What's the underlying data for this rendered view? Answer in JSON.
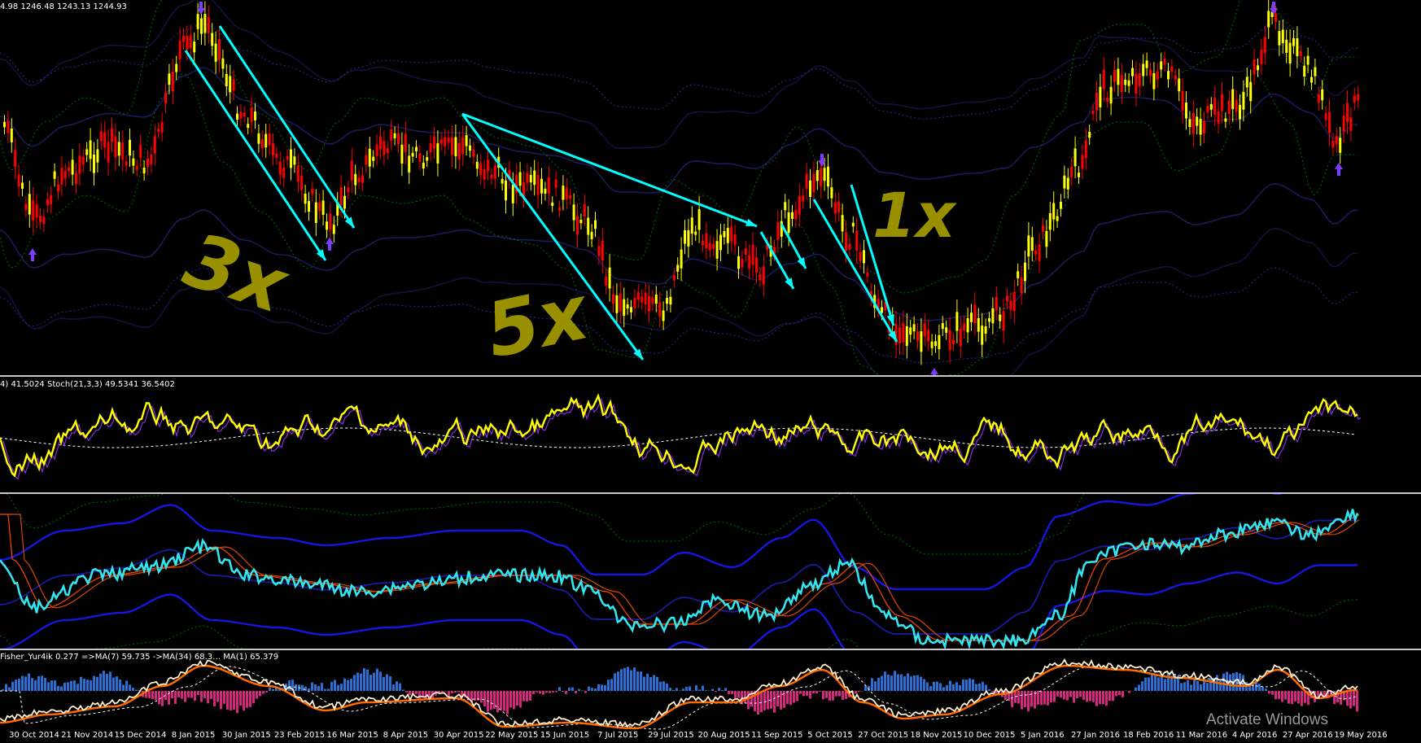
{
  "main_pane": {
    "ohlc_label": "4.98 1246.48 1243.13 1244.93",
    "annotations": [
      "3x",
      "5x",
      "1x"
    ]
  },
  "stoch_pane": {
    "label": "4) 41.5024   Stoch(21,3,3) 49.5341 36.5402"
  },
  "fisher_pane": {
    "label": "Fisher_Yur4ik 0.277  =>MA(7) 59.735  ->MA(34) 68.3… MA(1) 65.379"
  },
  "time_axis": [
    "30 Oct 2014",
    "21 Nov 2014",
    "15 Dec 2014",
    "8 Jan 2015",
    "30 Jan 2015",
    "23 Feb 2015",
    "16 Mar 2015",
    "8 Apr 2015",
    "30 Apr 2015",
    "22 May 2015",
    "15 Jun 2015",
    "7 Jul 2015",
    "29 Jul 2015",
    "20 Aug 2015",
    "11 Sep 2015",
    "5 Oct 2015",
    "27 Oct 2015",
    "18 Nov 2015",
    "10 Dec 2015",
    "5 Jan 2016",
    "27 Jan 2016",
    "18 Feb 2016",
    "11 Mar 2016",
    "4 Apr 2016",
    "27 Apr 2016",
    "19 May 2016"
  ],
  "watermark": "Activate Windows",
  "colors": {
    "candle_up": "#ffff00",
    "candle_down": "#ff0000",
    "arrow": "#00ffff",
    "bands": "#2b2b9a",
    "envelope": "#007000",
    "stoch": "#ffff00",
    "rsi": "#33e5f0",
    "hist_up": "#2a6fd6",
    "hist_down": "#d6277f"
  }
}
